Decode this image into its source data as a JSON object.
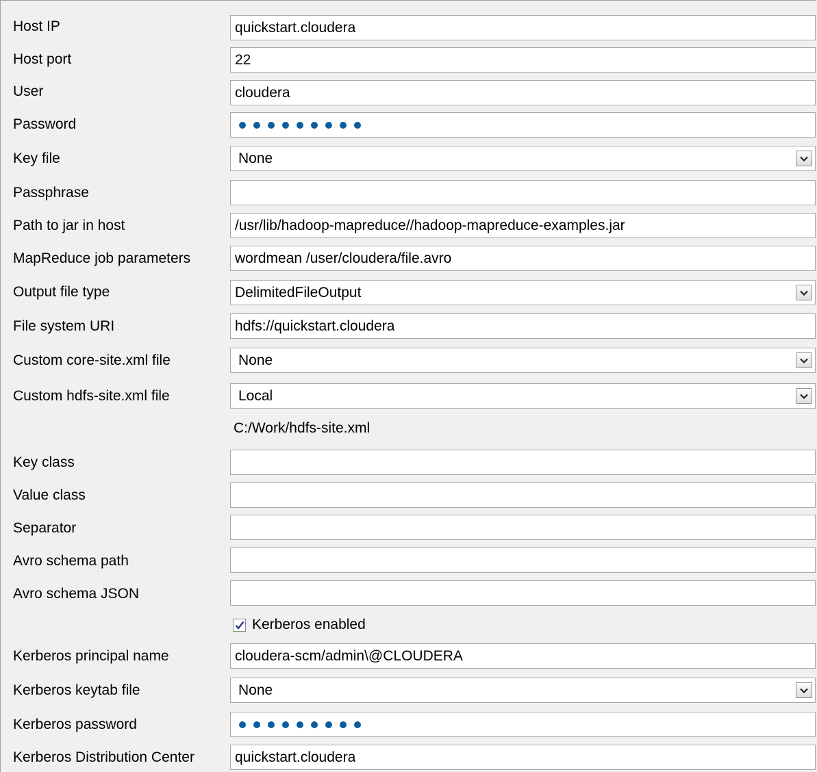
{
  "fields": {
    "host_ip": {
      "label": "Host IP",
      "value": "quickstart.cloudera"
    },
    "host_port": {
      "label": "Host port",
      "value": "22"
    },
    "user": {
      "label": "User",
      "value": "cloudera"
    },
    "password": {
      "label": "Password",
      "mask_count": 9
    },
    "key_file": {
      "label": "Key file",
      "value": "None"
    },
    "passphrase": {
      "label": "Passphrase",
      "value": ""
    },
    "jar_path": {
      "label": "Path to jar in host",
      "value": "/usr/lib/hadoop-mapreduce//hadoop-mapreduce-examples.jar"
    },
    "job_params": {
      "label": "MapReduce job parameters",
      "value": "wordmean /user/cloudera/file.avro"
    },
    "output_type": {
      "label": "Output file type",
      "value": "DelimitedFileOutput"
    },
    "fs_uri": {
      "label": "File system URI",
      "value": "hdfs://quickstart.cloudera"
    },
    "core_site": {
      "label": "Custom core-site.xml file",
      "value": "None"
    },
    "hdfs_site": {
      "label": "Custom hdfs-site.xml file",
      "value": "Local",
      "path": "C:/Work/hdfs-site.xml"
    },
    "key_class": {
      "label": "Key class",
      "value": ""
    },
    "value_class": {
      "label": "Value class",
      "value": ""
    },
    "separator": {
      "label": "Separator",
      "value": ""
    },
    "avro_path": {
      "label": "Avro schema path",
      "value": ""
    },
    "avro_json": {
      "label": "Avro schema JSON",
      "value": ""
    },
    "kerberos_enabled": {
      "label": "Kerberos enabled",
      "checked": true
    },
    "krb_principal": {
      "label": "Kerberos principal name",
      "value": "cloudera-scm/admin\\@CLOUDERA"
    },
    "krb_keytab": {
      "label": "Kerberos keytab file",
      "value": "None"
    },
    "krb_password": {
      "label": "Kerberos password",
      "mask_count": 9
    },
    "krb_kdc": {
      "label": "Kerberos Distribution Center",
      "value": "quickstart.cloudera"
    }
  },
  "colors": {
    "background": "#f0f0f0",
    "field_border": "#a8a8a8",
    "password_dot": "#0a5ea0"
  },
  "icons": {
    "combo_arrow": "chevron-down-icon",
    "checkbox": "checkmark-icon"
  }
}
